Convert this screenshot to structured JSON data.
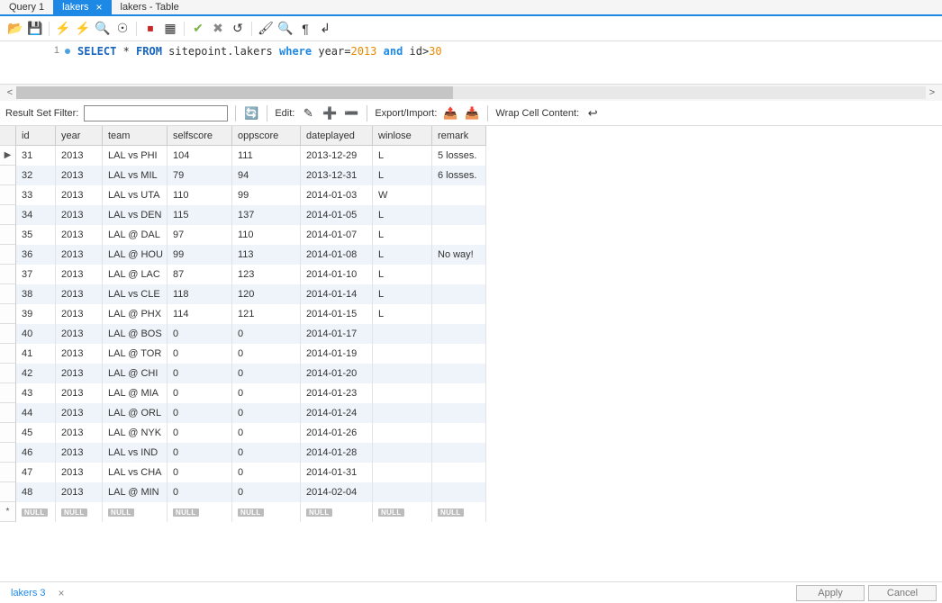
{
  "tabs": [
    {
      "label": "Query 1",
      "active": false,
      "closable": false
    },
    {
      "label": "lakers",
      "active": true,
      "closable": true
    },
    {
      "label": "lakers - Table",
      "active": false,
      "closable": false
    }
  ],
  "sql": {
    "lineno": "1",
    "text_parts": {
      "select": "SELECT",
      "star": " * ",
      "from": "FROM",
      "ident": " sitepoint.lakers ",
      "where": "where",
      "yearlit": " year=",
      "yval": "2013",
      "and": " and ",
      "idlit": "id>",
      "idval": "30"
    }
  },
  "filterbar": {
    "label": "Result Set Filter:",
    "editLabel": "Edit:",
    "exportLabel": "Export/Import:",
    "wrapLabel": "Wrap Cell Content:"
  },
  "columns": [
    "id",
    "year",
    "team",
    "selfscore",
    "oppscore",
    "dateplayed",
    "winlose",
    "remark"
  ],
  "rows": [
    {
      "id": "31",
      "year": "2013",
      "team": "LAL vs PHI",
      "selfscore": "104",
      "oppscore": "111",
      "dateplayed": "2013-12-29",
      "winlose": "L",
      "remark": "5 losses."
    },
    {
      "id": "32",
      "year": "2013",
      "team": "LAL vs MIL",
      "selfscore": "79",
      "oppscore": "94",
      "dateplayed": "2013-12-31",
      "winlose": "L",
      "remark": "6 losses."
    },
    {
      "id": "33",
      "year": "2013",
      "team": "LAL vs UTA",
      "selfscore": "110",
      "oppscore": "99",
      "dateplayed": "2014-01-03",
      "winlose": "W",
      "remark": ""
    },
    {
      "id": "34",
      "year": "2013",
      "team": "LAL vs DEN",
      "selfscore": "115",
      "oppscore": "137",
      "dateplayed": "2014-01-05",
      "winlose": "L",
      "remark": ""
    },
    {
      "id": "35",
      "year": "2013",
      "team": "LAL @ DAL",
      "selfscore": "97",
      "oppscore": "110",
      "dateplayed": "2014-01-07",
      "winlose": "L",
      "remark": ""
    },
    {
      "id": "36",
      "year": "2013",
      "team": "LAL @ HOU",
      "selfscore": "99",
      "oppscore": "113",
      "dateplayed": "2014-01-08",
      "winlose": "L",
      "remark": "No way!"
    },
    {
      "id": "37",
      "year": "2013",
      "team": "LAL @ LAC",
      "selfscore": "87",
      "oppscore": "123",
      "dateplayed": "2014-01-10",
      "winlose": "L",
      "remark": ""
    },
    {
      "id": "38",
      "year": "2013",
      "team": "LAL vs CLE",
      "selfscore": "118",
      "oppscore": "120",
      "dateplayed": "2014-01-14",
      "winlose": "L",
      "remark": ""
    },
    {
      "id": "39",
      "year": "2013",
      "team": "LAL @ PHX",
      "selfscore": "114",
      "oppscore": "121",
      "dateplayed": "2014-01-15",
      "winlose": "L",
      "remark": ""
    },
    {
      "id": "40",
      "year": "2013",
      "team": "LAL @ BOS",
      "selfscore": "0",
      "oppscore": "0",
      "dateplayed": "2014-01-17",
      "winlose": "",
      "remark": ""
    },
    {
      "id": "41",
      "year": "2013",
      "team": "LAL @ TOR",
      "selfscore": "0",
      "oppscore": "0",
      "dateplayed": "2014-01-19",
      "winlose": "",
      "remark": ""
    },
    {
      "id": "42",
      "year": "2013",
      "team": "LAL @ CHI",
      "selfscore": "0",
      "oppscore": "0",
      "dateplayed": "2014-01-20",
      "winlose": "",
      "remark": ""
    },
    {
      "id": "43",
      "year": "2013",
      "team": "LAL @ MIA",
      "selfscore": "0",
      "oppscore": "0",
      "dateplayed": "2014-01-23",
      "winlose": "",
      "remark": ""
    },
    {
      "id": "44",
      "year": "2013",
      "team": "LAL @ ORL",
      "selfscore": "0",
      "oppscore": "0",
      "dateplayed": "2014-01-24",
      "winlose": "",
      "remark": ""
    },
    {
      "id": "45",
      "year": "2013",
      "team": "LAL @ NYK",
      "selfscore": "0",
      "oppscore": "0",
      "dateplayed": "2014-01-26",
      "winlose": "",
      "remark": ""
    },
    {
      "id": "46",
      "year": "2013",
      "team": "LAL vs IND",
      "selfscore": "0",
      "oppscore": "0",
      "dateplayed": "2014-01-28",
      "winlose": "",
      "remark": ""
    },
    {
      "id": "47",
      "year": "2013",
      "team": "LAL vs CHA",
      "selfscore": "0",
      "oppscore": "0",
      "dateplayed": "2014-01-31",
      "winlose": "",
      "remark": ""
    },
    {
      "id": "48",
      "year": "2013",
      "team": "LAL @ MIN",
      "selfscore": "0",
      "oppscore": "0",
      "dateplayed": "2014-02-04",
      "winlose": "",
      "remark": ""
    }
  ],
  "nullLabel": "NULL",
  "footer": {
    "resultTab": "lakers 3",
    "applyLabel": "Apply",
    "cancelLabel": "Cancel"
  }
}
